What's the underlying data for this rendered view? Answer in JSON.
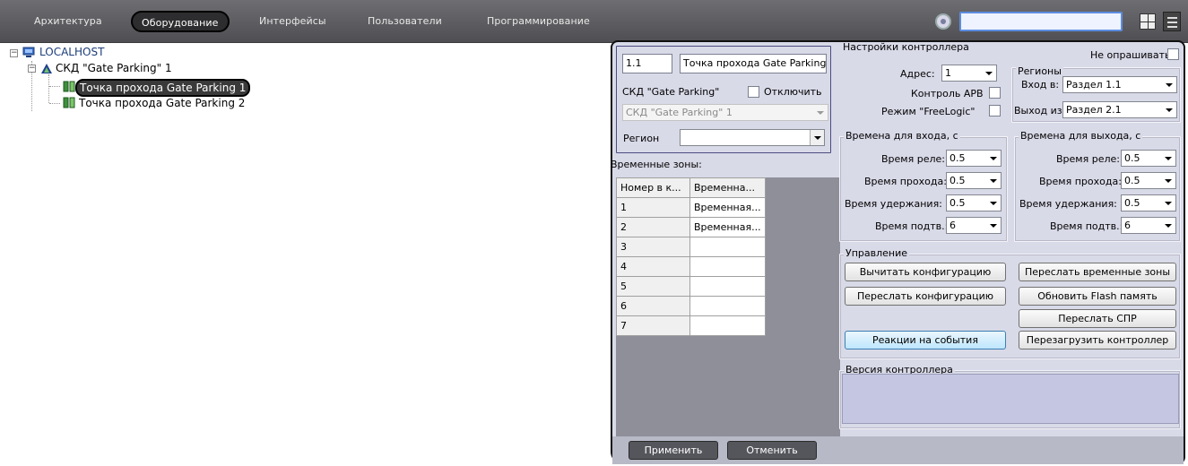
{
  "menu": {
    "items": [
      "Архитектура",
      "Оборудование",
      "Интерфейсы",
      "Пользователи",
      "Программирование"
    ],
    "active": "Оборудование"
  },
  "search": {
    "value": ""
  },
  "tree": {
    "root": "LOCALHOST",
    "controller": "СКД \"Gate Parking\" 1",
    "points": [
      "Точка прохода Gate Parking 1",
      "Точка прохода Gate Parking 2"
    ],
    "selected": "Точка прохода Gate Parking 1"
  },
  "point": {
    "id": "1.1",
    "name": "Точка прохода Gate Parking 1",
    "skd_label": "СКД \"Gate Parking\"",
    "disable_label": "Отключить",
    "skd_select": "СКД \"Gate Parking\" 1",
    "region_label": "Регион",
    "region_value": ""
  },
  "zones": {
    "title": "Временные зоны:",
    "headers": [
      "Номер в к...",
      "Временна..."
    ],
    "rows": [
      [
        "1",
        "Временная..."
      ],
      [
        "2",
        "Временная..."
      ],
      [
        "3",
        ""
      ],
      [
        "4",
        ""
      ],
      [
        "5",
        ""
      ],
      [
        "6",
        ""
      ],
      [
        "7",
        ""
      ]
    ]
  },
  "controller_settings": {
    "title": "Настройки контроллера",
    "address_label": "Адрес:",
    "address_value": "1",
    "apb_label": "Контроль APB",
    "freelogic_label": "Режим \"FreeLogic\""
  },
  "poll": {
    "label": "Не опрашивать"
  },
  "regions": {
    "title": "Регионы",
    "entry_label": "Вход в:",
    "entry_value": "Раздел 1.1",
    "exit_label": "Выход из:",
    "exit_value": "Раздел 2.1"
  },
  "entry_times": {
    "title": "Времена для входа, с",
    "relay_label": "Время реле:",
    "relay_value": "0.5",
    "pass_label": "Время прохода:",
    "pass_value": "0.5",
    "hold_label": "Время удержания:",
    "hold_value": "0.5",
    "confirm_label": "Время подтв.:",
    "confirm_value": "6"
  },
  "exit_times": {
    "title": "Времена для выхода, с",
    "relay_label": "Время реле:",
    "relay_value": "0.5",
    "pass_label": "Время прохода:",
    "pass_value": "0.5",
    "hold_label": "Время удержания:",
    "hold_value": "0.5",
    "confirm_label": "Время подтв.:",
    "confirm_value": "6"
  },
  "control": {
    "title": "Управление",
    "read_config": "Вычитать конфигурацию",
    "send_zones": "Переслать временные зоны",
    "send_config": "Переслать конфигурацию",
    "update_flash": "Обновить Flash память",
    "send_spr": "Переслать СПР",
    "reactions": "Реакции на события",
    "reboot": "Перезагрузить контроллер"
  },
  "version": {
    "title": "Версия контроллера",
    "value": ""
  },
  "footer": {
    "apply": "Применить",
    "cancel": "Отменить"
  }
}
